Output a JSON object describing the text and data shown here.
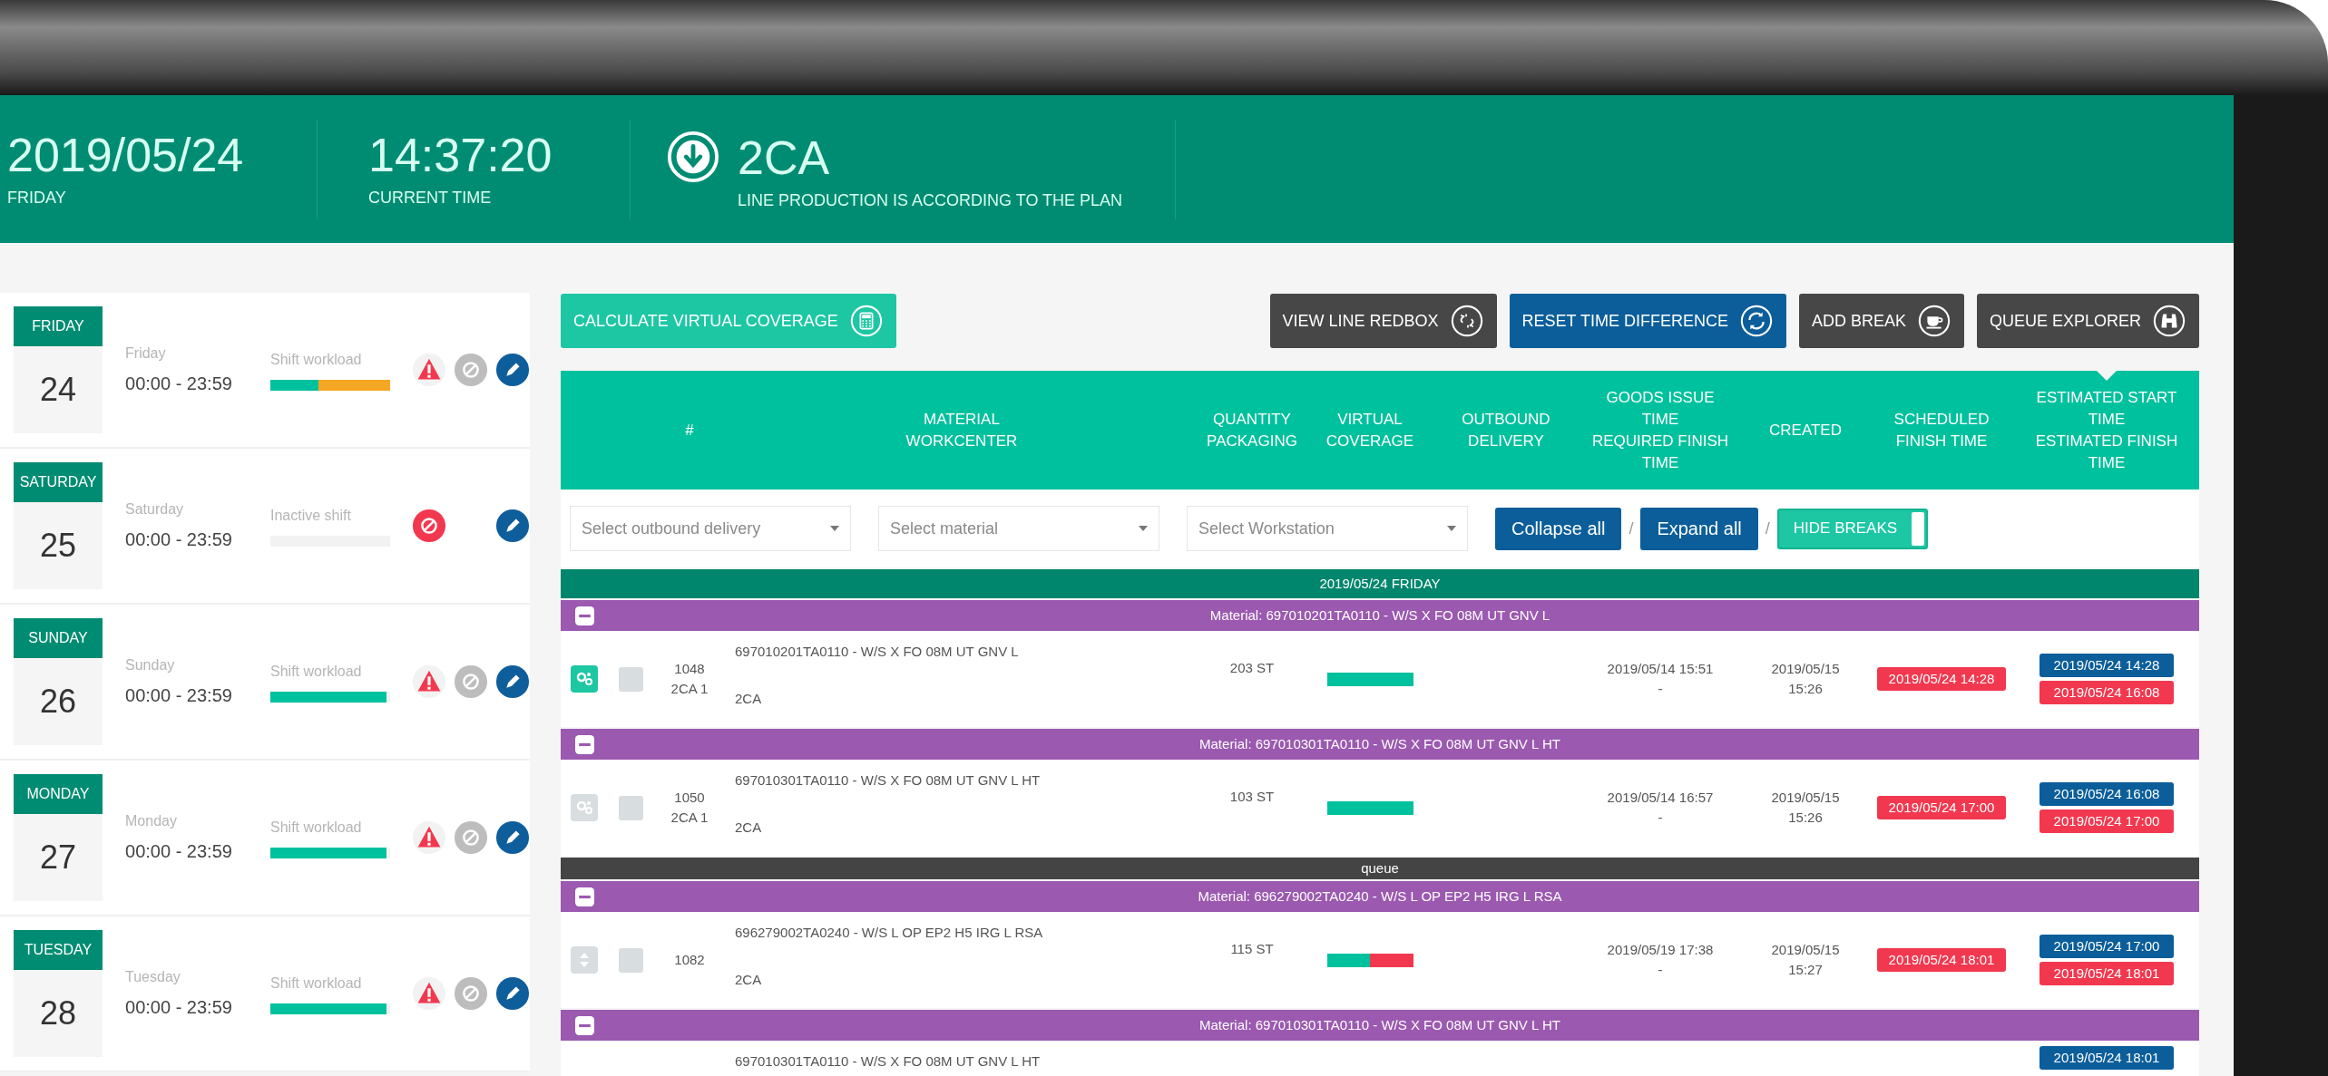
{
  "header": {
    "date": "2019/05/24",
    "weekday": "FRIDAY",
    "time": "14:37:20",
    "time_label": "CURRENT TIME",
    "line": "2CA",
    "line_status": "LINE PRODUCTION IS ACCORDING TO THE PLAN"
  },
  "days": [
    {
      "badge": "FRIDAY",
      "day": "24",
      "name": "Friday",
      "hours": "00:00 - 23:59",
      "status": "Shift workload",
      "active": true,
      "workload": [
        {
          "kind": "ok",
          "level": 0.4
        },
        {
          "kind": "over",
          "level": 0.6
        }
      ]
    },
    {
      "badge": "SATURDAY",
      "day": "25",
      "name": "Saturday",
      "hours": "00:00 - 23:59",
      "status": "Inactive shift",
      "active": false
    },
    {
      "badge": "SUNDAY",
      "day": "26",
      "name": "Sunday",
      "hours": "00:00 - 23:59",
      "status": "Shift workload",
      "active": true,
      "workload": [
        {
          "kind": "ok",
          "level": 0.97
        }
      ]
    },
    {
      "badge": "MONDAY",
      "day": "27",
      "name": "Monday",
      "hours": "00:00 - 23:59",
      "status": "Shift workload",
      "active": true,
      "workload": [
        {
          "kind": "ok",
          "level": 0.97
        }
      ]
    },
    {
      "badge": "TUESDAY",
      "day": "28",
      "name": "Tuesday",
      "hours": "00:00 - 23:59",
      "status": "Shift workload",
      "active": true,
      "workload": [
        {
          "kind": "ok",
          "level": 0.97
        }
      ]
    }
  ],
  "toolbar": [
    {
      "label": "CALCULATE VIRTUAL COVERAGE",
      "kind": "accent"
    },
    {
      "label": "VIEW LINE REDBOX",
      "kind": "dark"
    },
    {
      "label": "RESET TIME DIFFERENCE",
      "kind": "primary"
    },
    {
      "label": "ADD BREAK",
      "kind": "dark"
    },
    {
      "label": "QUEUE EXPLORER",
      "kind": "dark"
    }
  ],
  "table": {
    "columns": [
      {
        "lines": [
          "#"
        ],
        "sorted": false
      },
      {
        "lines": [
          "MATERIAL",
          "WORKCENTER"
        ],
        "sorted": false
      },
      {
        "lines": [
          "QUANTITY",
          "PACKAGING"
        ],
        "sorted": false
      },
      {
        "lines": [
          "VIRTUAL",
          "COVERAGE"
        ],
        "sorted": false
      },
      {
        "lines": [
          "OUTBOUND",
          "DELIVERY"
        ],
        "sorted": false
      },
      {
        "lines": [
          "GOODS ISSUE TIME",
          "REQUIRED FINISH TIME"
        ],
        "sorted": false
      },
      {
        "lines": [
          "CREATED"
        ],
        "sorted": false
      },
      {
        "lines": [
          "SCHEDULED FINISH TIME"
        ],
        "sorted": false
      },
      {
        "lines": [
          "ESTIMATED START TIME",
          "ESTIMATED FINISH TIME"
        ],
        "sorted": true
      }
    ],
    "filters": [
      {
        "placeholder": "Select outbound delivery"
      },
      {
        "placeholder": "Select material"
      },
      {
        "placeholder": "Select Workstation"
      }
    ],
    "controls": [
      {
        "kind": "button",
        "label": "Collapse all"
      },
      {
        "kind": "separator",
        "label": "/"
      },
      {
        "kind": "button",
        "label": "Expand all"
      },
      {
        "kind": "separator",
        "label": "/"
      },
      {
        "kind": "toggle",
        "label": "HIDE BREAKS",
        "on": true
      }
    ],
    "rows": [
      {
        "kind": "date",
        "label": "2019/05/24 FRIDAY"
      },
      {
        "kind": "material",
        "label": "Material: 697010201TA0110 - W/S X FO 08M UT GNV L",
        "expanded": true
      },
      {
        "kind": "item",
        "reorderable": false,
        "enabled": true,
        "checked": false,
        "number": "1048",
        "line": "2CA 1",
        "material": "697010201TA0110 - W/S X FO 08M UT GNV L",
        "workcenter": "2CA",
        "quantity": "203 ST",
        "coverage": [
          {
            "kind": "ok",
            "level": 1
          }
        ],
        "goods_issue": "2019/05/14 15:51",
        "required_finish": "-",
        "created": "2019/05/15 15:26",
        "scheduled_finish": "2019/05/24 14:28",
        "estimated_start": "2019/05/24 14:28",
        "estimated_finish": "2019/05/24 16:08"
      },
      {
        "kind": "material",
        "label": "Material: 697010301TA0110 - W/S X FO 08M UT GNV L HT",
        "expanded": true
      },
      {
        "kind": "item",
        "reorderable": false,
        "enabled": false,
        "checked": false,
        "number": "1050",
        "line": "2CA 1",
        "material": "697010301TA0110 - W/S X FO 08M UT GNV L HT",
        "workcenter": "2CA",
        "quantity": "103 ST",
        "coverage": [
          {
            "kind": "ok",
            "level": 1
          }
        ],
        "goods_issue": "2019/05/14 16:57",
        "required_finish": "-",
        "created": "2019/05/15 15:26",
        "scheduled_finish": "2019/05/24 17:00",
        "estimated_start": "2019/05/24 16:08",
        "estimated_finish": "2019/05/24 17:00"
      },
      {
        "kind": "queue",
        "label": "queue"
      },
      {
        "kind": "material",
        "label": "Material: 696279002TA0240 - W/S L OP EP2 H5 IRG L RSA",
        "expanded": true
      },
      {
        "kind": "item",
        "reorderable": true,
        "enabled": false,
        "checked": false,
        "number": "1082",
        "material": "696279002TA0240 - W/S L OP EP2 H5 IRG L RSA",
        "workcenter": "2CA",
        "quantity": "115 ST",
        "coverage": [
          {
            "kind": "ok",
            "level": 0.5
          },
          {
            "kind": "short",
            "level": 0.5
          }
        ],
        "goods_issue": "2019/05/19 17:38",
        "required_finish": "-",
        "created": "2019/05/15 15:27",
        "scheduled_finish": "2019/05/24 18:01",
        "estimated_start": "2019/05/24 17:00",
        "estimated_finish": "2019/05/24 18:01"
      },
      {
        "kind": "material",
        "label": "Material: 697010301TA0110 - W/S X FO 08M UT GNV L HT",
        "expanded": true
      },
      {
        "kind": "item",
        "material": "697010301TA0110 - W/S X FO 08M UT GNV L HT",
        "estimated_start": "2019/05/24 18:01"
      }
    ]
  }
}
